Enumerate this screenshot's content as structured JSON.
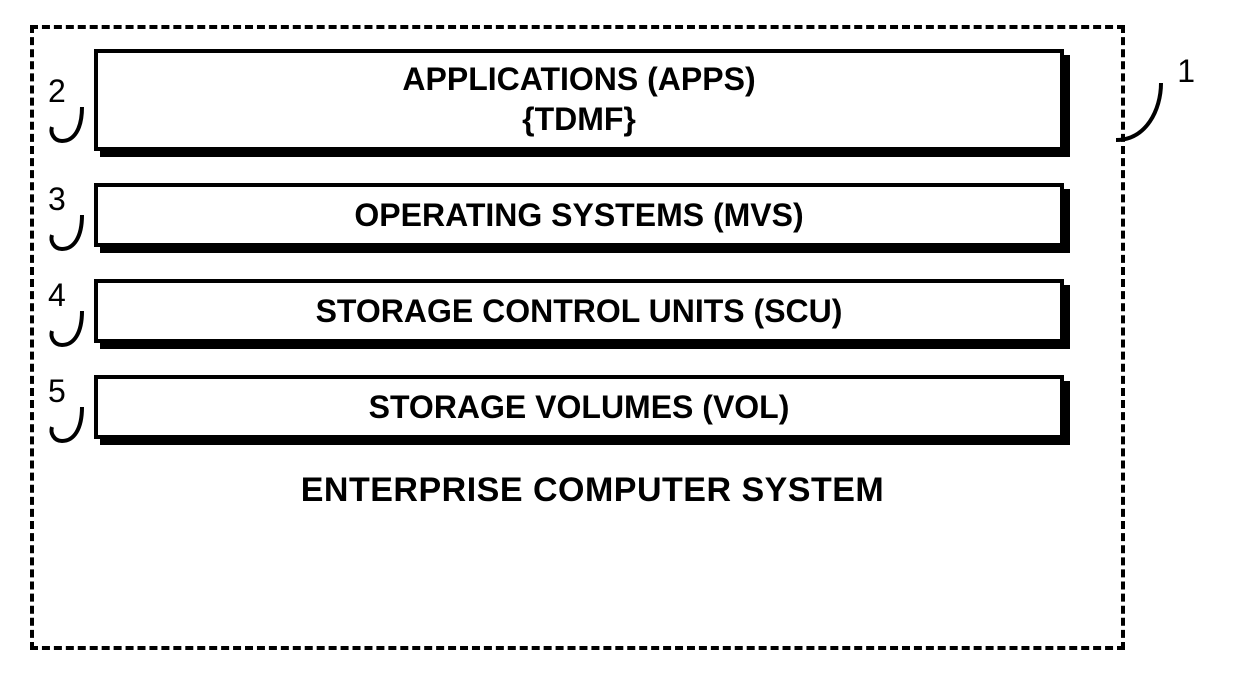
{
  "diagram": {
    "title": "ENTERPRISE COMPUTER SYSTEM",
    "outer_ref": "1",
    "layers": [
      {
        "ref": "2",
        "line1": "APPLICATIONS (APPS)",
        "line2": "{TDMF}"
      },
      {
        "ref": "3",
        "line1": "OPERATING SYSTEMS (MVS)",
        "line2": ""
      },
      {
        "ref": "4",
        "line1": "STORAGE CONTROL UNITS (SCU)",
        "line2": ""
      },
      {
        "ref": "5",
        "line1": "STORAGE VOLUMES (VOL)",
        "line2": ""
      }
    ]
  }
}
